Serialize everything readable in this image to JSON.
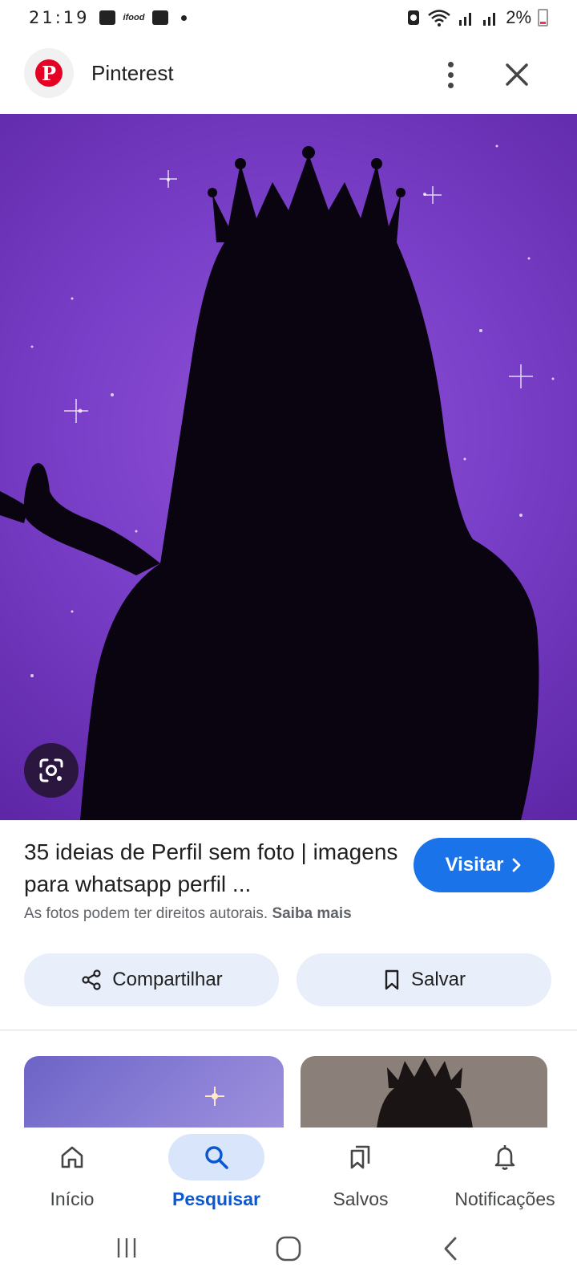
{
  "status_bar": {
    "time": "21:19",
    "ifood_label": "ifood",
    "battery": "2%"
  },
  "header": {
    "title": "Pinterest",
    "logo_letter": "P"
  },
  "result": {
    "title": "35 ideias de Perfil sem foto | imagens para whatsapp perfil ...",
    "visit_label": "Visitar",
    "copyright_text": "As fotos podem ter direitos autorais.",
    "learn_more": "Saiba mais",
    "share_label": "Compartilhar",
    "save_label": "Salvar"
  },
  "bottom_nav": {
    "items": [
      {
        "label": "Início",
        "icon": "home-icon",
        "active": false
      },
      {
        "label": "Pesquisar",
        "icon": "search-icon",
        "active": true
      },
      {
        "label": "Salvos",
        "icon": "bookmarks-icon",
        "active": false
      },
      {
        "label": "Notificações",
        "icon": "bell-icon",
        "active": false
      }
    ]
  },
  "colors": {
    "accent": "#1a73e8",
    "pinterest": "#e60023",
    "image_purple": "#7a3fc8"
  }
}
